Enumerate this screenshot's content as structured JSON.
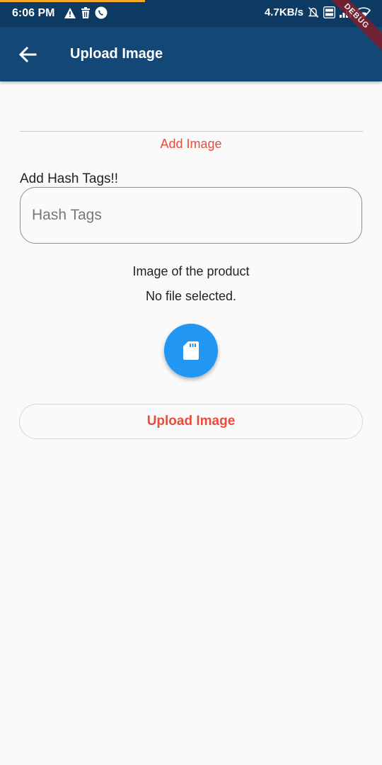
{
  "status_bar": {
    "time": "6:06 PM",
    "speed": "4.7KB/s",
    "icons": [
      "warning-icon",
      "trash-icon",
      "whatsapp-icon",
      "bell-off-icon",
      "volte-icon",
      "signal-icon",
      "wifi-icon"
    ]
  },
  "app_bar": {
    "title": "Upload Image",
    "back_icon": "arrow-left-icon",
    "debug_label": "DEBUG"
  },
  "form": {
    "add_image_label": "Add Image",
    "hash_label": "Add Hash Tags!!",
    "hash_placeholder": "Hash Tags",
    "hash_value": "",
    "product_caption": "Image of the product",
    "file_status": "No file selected.",
    "fab_icon": "sd-card-icon",
    "upload_button_label": "Upload Image"
  },
  "colors": {
    "status_bar": "#0d3a63",
    "app_bar": "#134876",
    "accent_red": "#e74c3c",
    "fab_blue": "#2196f3",
    "background": "#fafafa"
  }
}
